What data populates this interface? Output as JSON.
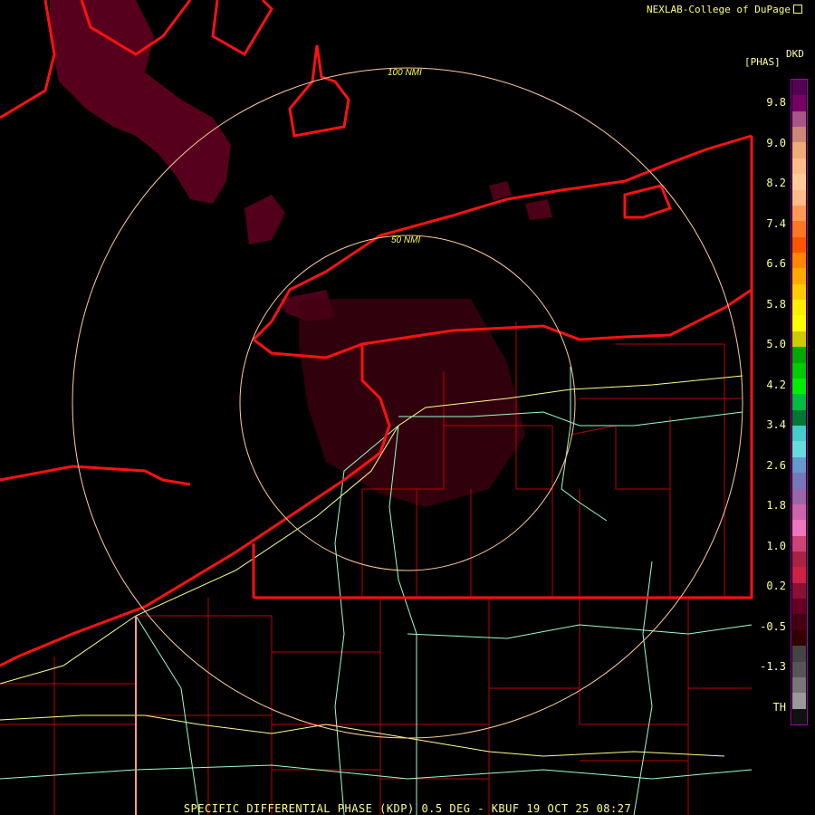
{
  "credit": "NEXLAB-College of DuPage",
  "logo_icon": "nexlab-logo-icon",
  "legend": {
    "product": "DKD",
    "unit": "[PHAS]",
    "ticks": [
      "9.8",
      "9.0",
      "8.2",
      "7.4",
      "6.6",
      "5.8",
      "5.0",
      "4.2",
      "3.4",
      "2.6",
      "1.8",
      "1.0",
      "0.2",
      "-0.5",
      "-1.3",
      "TH"
    ],
    "colors": [
      "#550055",
      "#770066",
      "#aa5588",
      "#cc8877",
      "#eeaa77",
      "#ffbb88",
      "#ffcc99",
      "#ffbb88",
      "#ff9955",
      "#ff7722",
      "#ff5500",
      "#ff8800",
      "#ffaa00",
      "#ffcc00",
      "#ffee00",
      "#ffff00",
      "#cccc00",
      "#00aa00",
      "#00cc00",
      "#00ee00",
      "#00bb44",
      "#007733",
      "#44cccc",
      "#66dddd",
      "#6699cc",
      "#7777bb",
      "#9966aa",
      "#cc66aa",
      "#ee77bb",
      "#cc4477",
      "#aa2244",
      "#cc2244",
      "#881133",
      "#660022",
      "#440011",
      "#330000",
      "#444444",
      "#555555",
      "#777777",
      "#999999",
      "#111111"
    ]
  },
  "range_rings": [
    "100 NMI",
    "50 NMI"
  ],
  "title": "SPECIFIC DIFFERENTIAL PHASE (KDP) 0.5 DEG - KBUF 19 OCT 25 08:27"
}
